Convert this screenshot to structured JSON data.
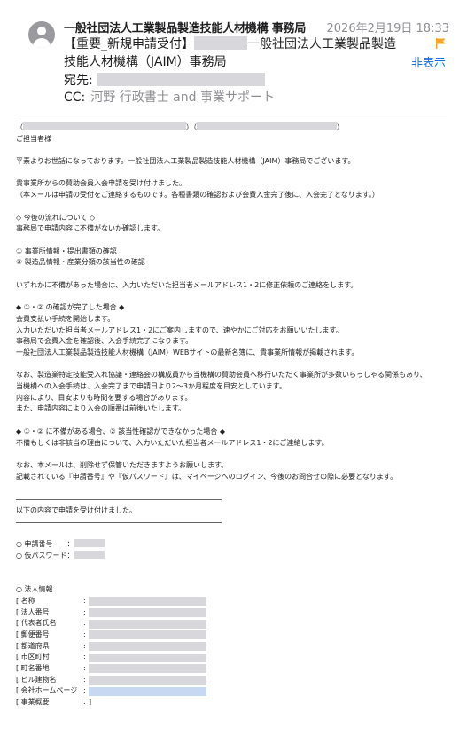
{
  "header": {
    "sender": "一般社団法人工業製品製造技能人材機構 事務局",
    "datetime": "2026年2月19日 18:33",
    "subject_prefix": "【重要_新規申請受付】",
    "subject_suffix": "一般社団法人工業製品製造",
    "subject_line2": "技能人材機構（JAIM）事務局",
    "to_label": "宛先:",
    "cc_label": "CC:",
    "cc_value": "河野 行政書士 and 事業サポート",
    "hide_label": "非表示",
    "flag_color": "#f5a623"
  },
  "body": {
    "paren_open": "（",
    "paren_mid": "）（",
    "paren_close": "）",
    "greeting": "ご担当者様",
    "intro": "平素よりお世話になっております。一般社団法人工業製品製造技能人材機構（JAIM）事務局でございます。",
    "accept1": "貴事業所からの賛助会員入会申請を受け付けました。",
    "accept2": "（本メールは申請の受付をご連絡するものです。各種書類の確認および会費入金完了後に、入会完了となります。）",
    "flow_title": "◇ 今後の流れについて ◇",
    "flow_desc": "事務局で申請内容に不備がないか確認します。",
    "check1": "① 事業所情報・提出書類の確認",
    "check2": "② 製造品情報・産業分類の該当性の確認",
    "fix_note": "いずれかに不備があった場合は、入力いただいた担当者メールアドレス1・2に修正依頼のご連絡をします。",
    "done_title": "◆ ①・② の確認が完了した場合 ◆",
    "done1": "会費支払い手続を開始します。",
    "done2": "入力いただいた担当者メールアドレス1・2にご案内しますので、速やかにご対応をお願いいたします。",
    "done3": "事務局で会費入金を確認後、入会手続完了になります。",
    "done4": "一般社団法人工業製品製造技能人材機構（JAIM）WEBサイトの最新名簿に、貴事業所情報が掲載されます。",
    "note1": "なお、製造業特定技能受入れ協議・連絡会の構成員から当機構の賛助会員へ移行いただく事業所が多数いらっしゃる関係もあり、",
    "note2": "当機構への入会手続は、入会完了まで申請日より2〜3か月程度を目安としています。",
    "note3": "内容により、目安よりも時間を要する場合があります。",
    "note4": "また、申請内容により入会の順番は前後いたします。",
    "ng_title": "◆ ①・② に不備がある場合、② 該当性確認ができなかった場合 ◆",
    "ng_desc": "不備もしくは非該当の理由について、入力いただいた担当者メールアドレス1・2にご連絡します。",
    "keep1": "なお、本メールは、削除せず保管いただきますようお願いします。",
    "keep2": "記載されている『申請番号』や『仮パスワード』は、マイページへのログイン、今後のお問合せの際に必要となります。",
    "received": "以下の内容で申請を受け付けました。",
    "app_no_label": "○ 申請番号　　：",
    "temp_pw_label": "○ 仮パスワード：",
    "corp_info_title": "○ 法人情報",
    "corp_fields": [
      "[ 名称",
      "[ 法人番号",
      "[ 代表者氏名",
      "[ 郵便番号",
      "[ 都道府県",
      "[ 市区町村",
      "[ 町名番地",
      "[ ビル建物名",
      "[ 会社ホームページ",
      "[ 事業概要"
    ],
    "colon": ":",
    "last_bracket": "]"
  }
}
